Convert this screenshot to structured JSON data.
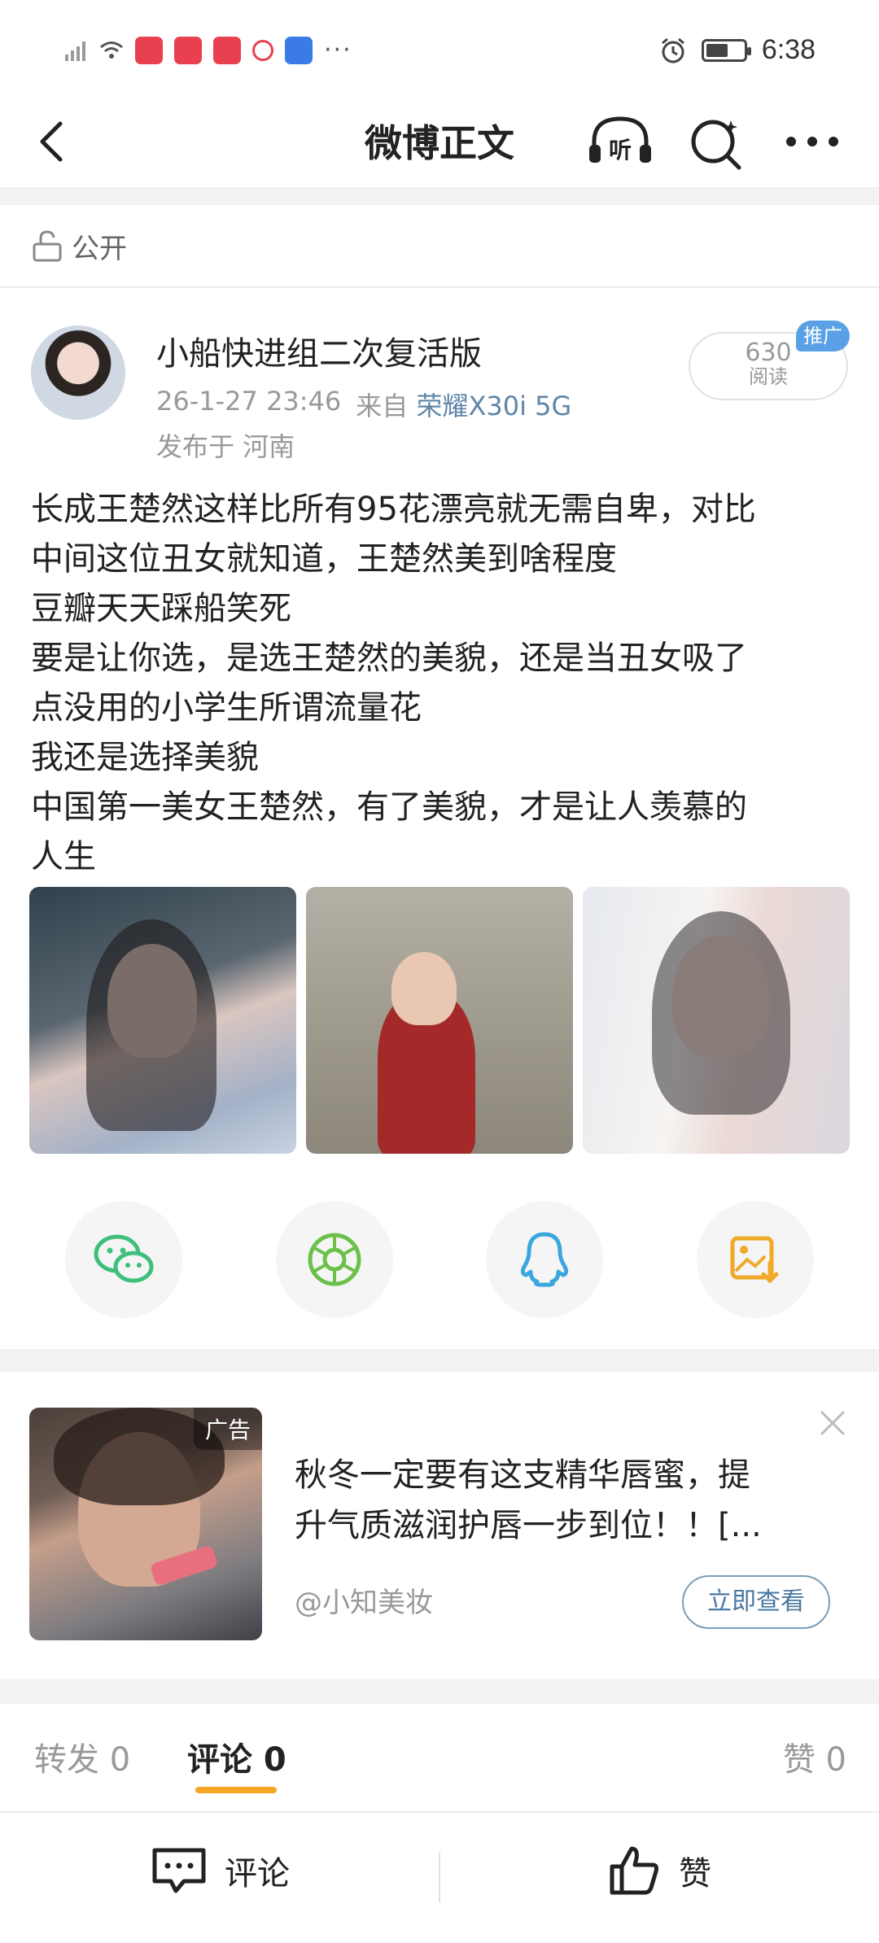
{
  "status_bar": {
    "time": "6:38",
    "overflow": "···",
    "battery_level": 0.6
  },
  "nav": {
    "title": "微博正文",
    "listen_label": "听"
  },
  "visibility": {
    "label": "公开"
  },
  "post": {
    "author": "小船快进组二次复活版",
    "timestamp": "26-1-27 23:46",
    "source_prefix": "来自",
    "device": "荣耀X30i 5G",
    "location": "发布于 河南",
    "read_count": "630",
    "read_label": "阅读",
    "promo_badge": "推广",
    "lines": [
      "长成王楚然这样比所有95花漂亮就无需自卑，对比",
      "中间这位丑女就知道，王楚然美到啥程度",
      "豆瓣天天踩船笑死",
      "要是让你选，是选王楚然的美貌，还是当丑女吸了",
      "点没用的小学生所谓流量花",
      "我还是选择美貌",
      "中国第一美女王楚然，有了美貌，才是让人羡慕的",
      "人生"
    ]
  },
  "share": {
    "icons": [
      "wechat-icon",
      "moments-icon",
      "qq-icon",
      "save-image-icon"
    ],
    "colors": {
      "wechat": "#3ebf7a",
      "moments": "#6cc04a",
      "qq": "#3aa6de",
      "save": "#f0a928"
    }
  },
  "ad": {
    "tag": "广告",
    "title_lines": [
      "秋冬一定要有这支精华唇蜜，提",
      "升气质滋润护唇一步到位！！[..."
    ],
    "source": "@小知美妆",
    "cta": "立即查看"
  },
  "tabs": {
    "repost": "转发 0",
    "comments": "评论 0",
    "likes": "赞 0"
  },
  "bottom_bar": {
    "comment": "评论",
    "like": "赞"
  },
  "colors": {
    "accent": "#f5a623",
    "link": "#5f86a8",
    "promo": "#5aa0e6"
  }
}
